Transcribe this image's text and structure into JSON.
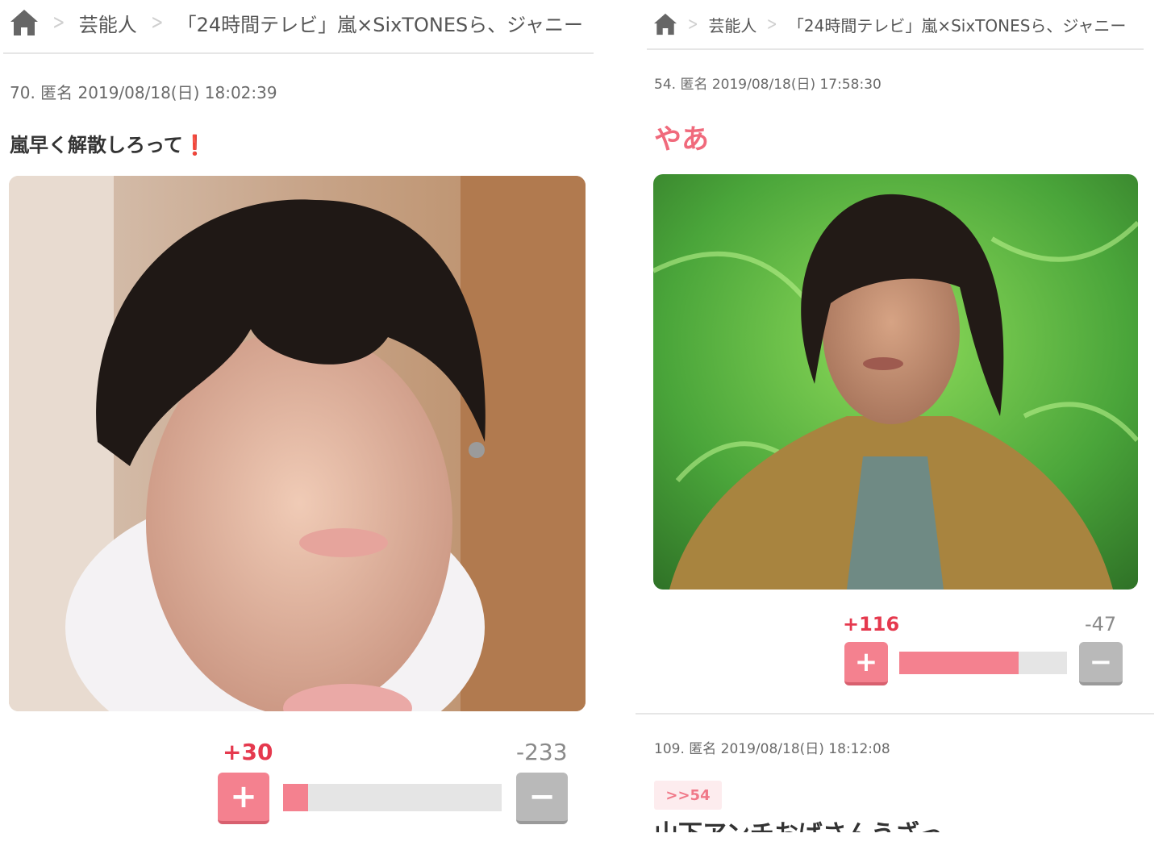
{
  "left": {
    "breadcrumb": {
      "home_icon": "home-icon",
      "category": "芸能人",
      "title": "「24時間テレビ」嵐×SixTONESら、ジャニー"
    },
    "post": {
      "meta": "70. 匿名 2019/08/18(日) 18:02:39",
      "comment": "嵐早く解散しろって",
      "comment_emoji": "❗",
      "vote": {
        "plus": "+30",
        "minus": "-233",
        "plus_ratio": 0.114
      }
    }
  },
  "right": {
    "breadcrumb": {
      "home_icon": "home-icon",
      "category": "芸能人",
      "title": "「24時間テレビ」嵐×SixTONESら、ジャニー"
    },
    "post": {
      "meta": "54. 匿名 2019/08/18(日) 17:58:30",
      "comment": "やあ",
      "vote": {
        "plus": "+116",
        "minus": "-47",
        "plus_ratio": 0.712
      }
    },
    "next_post": {
      "meta": "109. 匿名 2019/08/18(日) 18:12:08",
      "reply_tag": ">>54",
      "comment_partial": "山下アンチおばさんうざっ"
    }
  },
  "buttons": {
    "plus_symbol": "+",
    "minus_symbol": "−"
  },
  "colors": {
    "accent_pink": "#f4818f",
    "plus_red": "#e5394e",
    "minus_grey": "#b9b9b9"
  }
}
